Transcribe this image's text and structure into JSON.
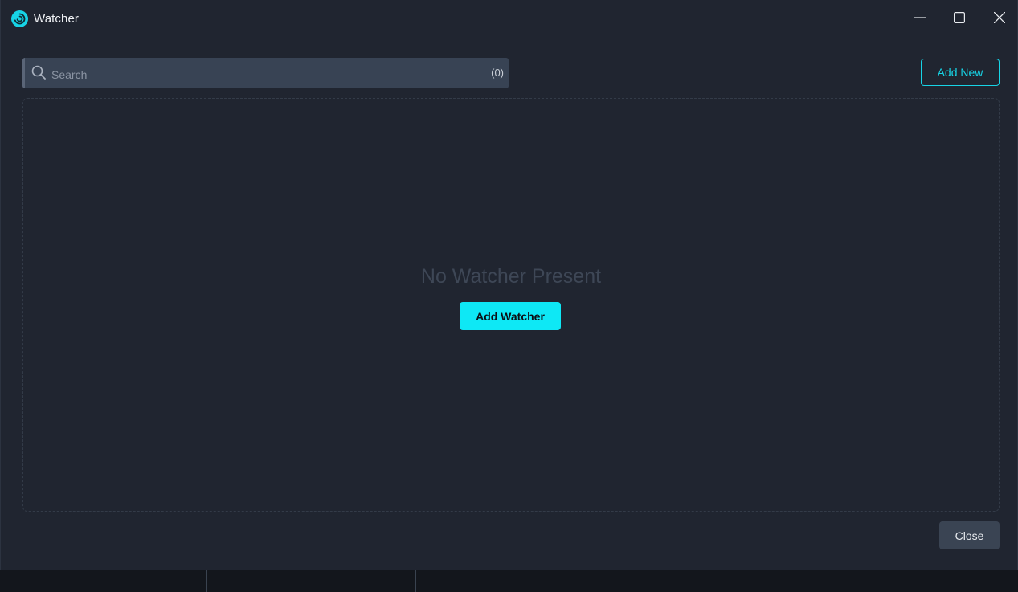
{
  "window": {
    "title": "Watcher"
  },
  "search": {
    "placeholder": "Search",
    "value": "",
    "count": "(0)"
  },
  "toolbar": {
    "add_new_label": "Add New"
  },
  "empty_state": {
    "message": "No Watcher Present",
    "add_watcher_label": "Add Watcher"
  },
  "footer": {
    "close_label": "Close"
  },
  "icons": {
    "app": "app-logo-icon",
    "search": "search-icon",
    "minimize": "minimize-icon",
    "maximize": "maximize-icon",
    "close": "close-icon"
  },
  "colors": {
    "accent": "#0ee8f5",
    "background": "#202530",
    "search_bg": "#384354",
    "muted_text": "#3e4756"
  }
}
